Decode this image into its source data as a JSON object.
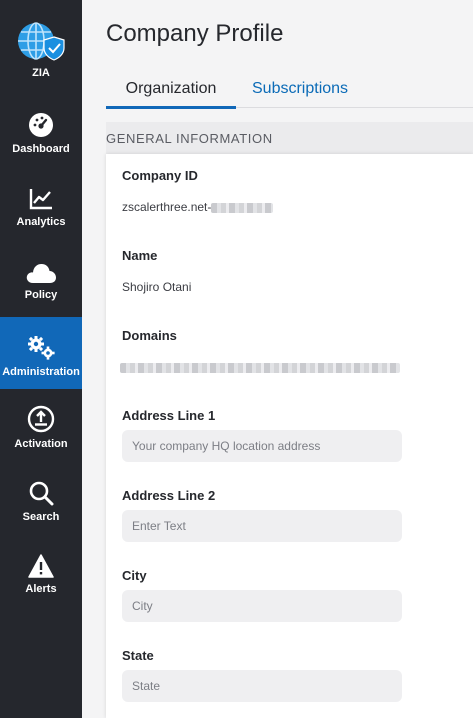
{
  "sidebar": {
    "product": "ZIA",
    "items": [
      {
        "label": "Dashboard",
        "icon": "dashboard-icon"
      },
      {
        "label": "Analytics",
        "icon": "analytics-icon"
      },
      {
        "label": "Policy",
        "icon": "cloud-icon"
      },
      {
        "label": "Administration",
        "icon": "gears-icon",
        "active": true
      },
      {
        "label": "Activation",
        "icon": "activation-icon"
      },
      {
        "label": "Search",
        "icon": "search-icon"
      },
      {
        "label": "Alerts",
        "icon": "alert-icon"
      }
    ]
  },
  "page": {
    "title": "Company Profile",
    "tabs": [
      {
        "label": "Organization",
        "active": true
      },
      {
        "label": "Subscriptions",
        "active": false
      }
    ],
    "section_title": "GENERAL INFORMATION"
  },
  "form": {
    "company_id": {
      "label": "Company ID",
      "value": "zscalerthree.net-"
    },
    "name": {
      "label": "Name",
      "value": "Shojiro Otani"
    },
    "domains": {
      "label": "Domains"
    },
    "address1": {
      "label": "Address Line 1",
      "placeholder": "Your company HQ location address"
    },
    "address2": {
      "label": "Address Line 2",
      "placeholder": "Enter Text"
    },
    "city": {
      "label": "City",
      "placeholder": "City"
    },
    "state": {
      "label": "State",
      "placeholder": "State"
    }
  },
  "colors": {
    "sidebar_bg": "#25272d",
    "accent": "#1168b8",
    "tab_link": "#0b6bb7"
  }
}
